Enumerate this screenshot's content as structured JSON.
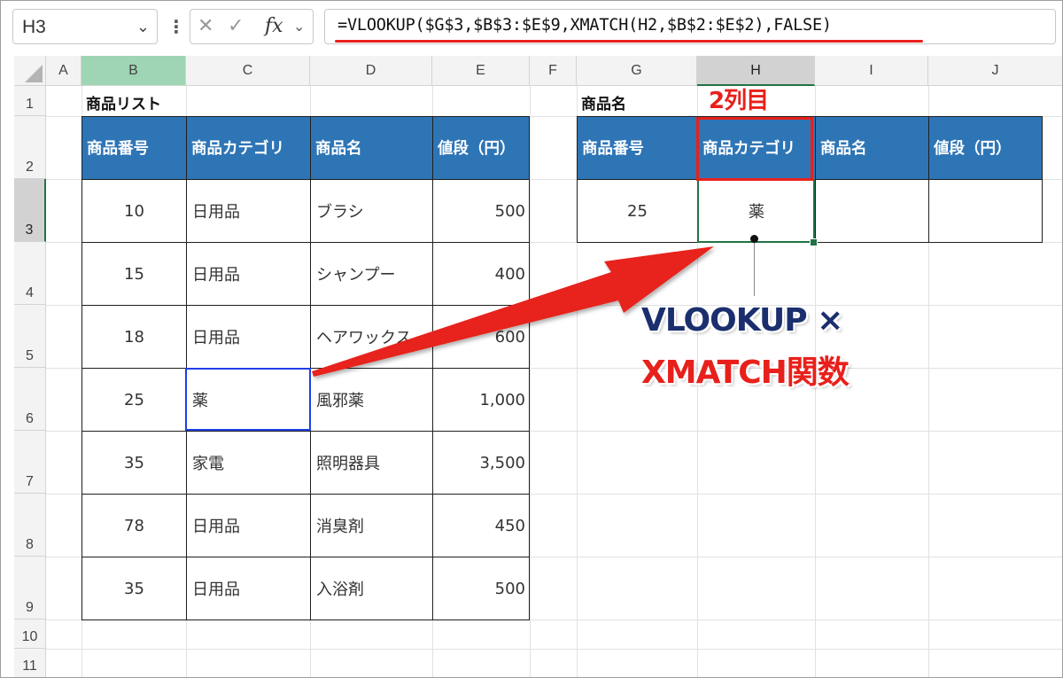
{
  "name_box": {
    "value": "H3"
  },
  "formula_bar": {
    "cancel_glyph": "✕",
    "enter_glyph": "✓",
    "fx_label": "fx",
    "formula": "=VLOOKUP($G$3,$B$3:$E$9,XMATCH(H2,$B$2:$E$2),FALSE)"
  },
  "columns": [
    "A",
    "B",
    "C",
    "D",
    "E",
    "F",
    "G",
    "H",
    "I",
    "J"
  ],
  "rows": [
    "1",
    "2",
    "3",
    "4",
    "5",
    "6",
    "7",
    "8",
    "9",
    "10",
    "11"
  ],
  "left_table": {
    "title": "商品リスト",
    "headers": [
      "商品番号",
      "商品カテゴリ",
      "商品名",
      "値段（円）"
    ],
    "rows": [
      [
        "10",
        "日用品",
        "ブラシ",
        "500"
      ],
      [
        "15",
        "日用品",
        "シャンプー",
        "400"
      ],
      [
        "18",
        "日用品",
        "ヘアワックス",
        "600"
      ],
      [
        "25",
        "薬",
        "風邪薬",
        "1,000"
      ],
      [
        "35",
        "家電",
        "照明器具",
        "3,500"
      ],
      [
        "78",
        "日用品",
        "消臭剤",
        "450"
      ],
      [
        "35",
        "日用品",
        "入浴剤",
        "500"
      ]
    ]
  },
  "right_table": {
    "title": "商品名",
    "headers": [
      "商品番号",
      "商品カテゴリ",
      "商品名",
      "値段（円）"
    ],
    "row": [
      "25",
      "薬",
      "",
      ""
    ]
  },
  "annotations": {
    "column_label": "2列目",
    "callout_line1": "VLOOKUP ×",
    "callout_line2": "XMATCH関数",
    "accent_red": "#e8201b",
    "accent_navy": "#1b2f6e",
    "header_blue": "#2e75b6",
    "excel_green": "#217346"
  }
}
